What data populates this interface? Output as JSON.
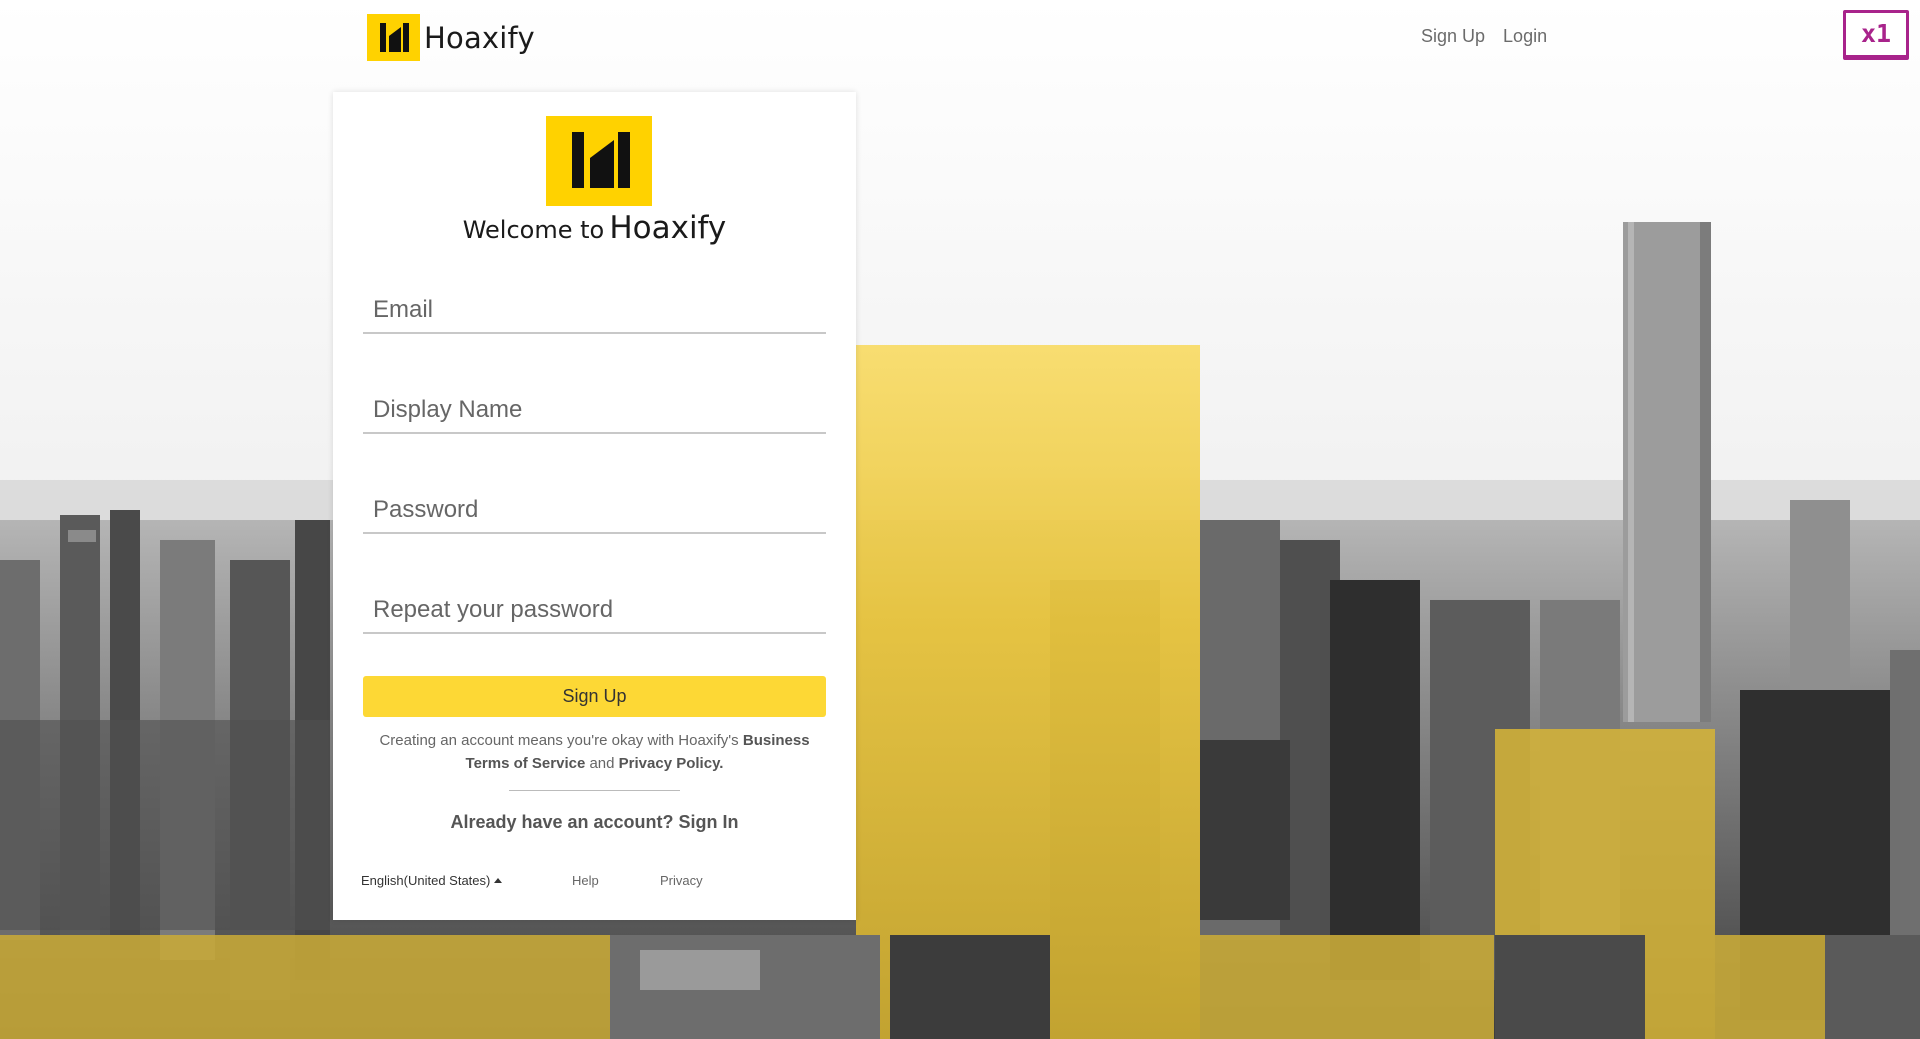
{
  "header": {
    "brand_name": "Hoaxify",
    "nav": {
      "signup_label": "Sign Up",
      "login_label": "Login"
    },
    "zoom_badge": "x1"
  },
  "card": {
    "welcome_prefix": "Welcome to",
    "welcome_brand": "Hoaxify",
    "fields": {
      "email_placeholder": "Email",
      "display_name_placeholder": "Display Name",
      "password_placeholder": "Password",
      "repeat_password_placeholder": "Repeat your password"
    },
    "signup_button_label": "Sign Up",
    "terms": {
      "text_before": "Creating an account means you're okay with Hoaxify's",
      "business_terms": "Business Terms of Service",
      "and": "and",
      "privacy_policy": "Privacy Policy."
    },
    "signin_text": "Already have an account? Sign In",
    "footer": {
      "language": "English(United States)",
      "help": "Help",
      "privacy": "Privacy"
    }
  },
  "colors": {
    "brand_yellow": "#ffd200",
    "button_yellow": "#fdd835",
    "badge_magenta": "#a8238b"
  },
  "icons": {
    "brand_logo": "hoaxify-h-logo",
    "language_caret": "caret-up-icon"
  }
}
